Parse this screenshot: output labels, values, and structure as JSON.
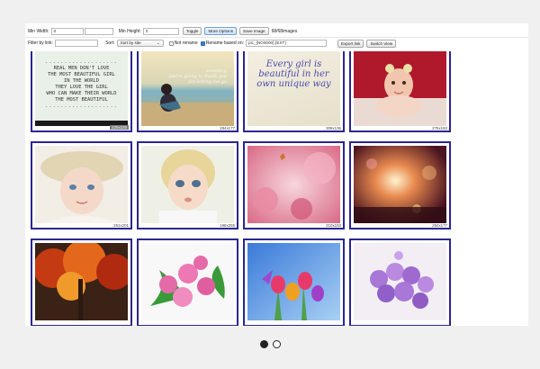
{
  "toolbar": {
    "min_width_label": "Min Width:",
    "min_width_value": "0",
    "min_height_label": "Min Height:",
    "min_height_value": "0",
    "toggle_label": "Toggle",
    "more_options_label": "More Options",
    "save_image_label": "Save Image",
    "images_count": "68/68images",
    "filter_label": "Filter by link:",
    "filter_value": "",
    "sort_label": "Sort:",
    "sort_value": "Sort by site",
    "not_rename_label": "Not rename",
    "not_rename_checked": false,
    "rename_label": "Rename based on:",
    "rename_checked": true,
    "rename_value": "pic_{NO0000}.{EXT}",
    "export_link_label": "Export link",
    "switch_view_label": "Switch View"
  },
  "tiles": [
    {
      "kind": "poem",
      "dims": "225x225",
      "lines": [
        "REAL MEN DON'T LOVE",
        "THE MOST BEAUTIFUL GIRL",
        "IN THE WORLD",
        "THEY LOVE THE GIRL",
        "WHO CAN MAKE THEIR WORLD",
        "THE MOST BEAUTIFUL"
      ],
      "dots": "..................."
    },
    {
      "kind": "beach",
      "dims": "284x177",
      "text_lines": [
        "someday,",
        "you're going to thank you",
        "for letting me go"
      ]
    },
    {
      "kind": "quote",
      "dims": "309x136",
      "lines": [
        "Every girl is",
        "beautiful in her",
        "own unique way"
      ]
    },
    {
      "kind": "baby-pink",
      "dims": "275x183"
    },
    {
      "kind": "baby-hat",
      "dims": "251x201"
    },
    {
      "kind": "toddler",
      "dims": "198x255"
    },
    {
      "kind": "pink-blossom",
      "dims": "310x163"
    },
    {
      "kind": "bokeh",
      "dims": "284x177"
    },
    {
      "kind": "autumn",
      "dims": ""
    },
    {
      "kind": "roses",
      "dims": ""
    },
    {
      "kind": "tulips",
      "dims": ""
    },
    {
      "kind": "purple-roses",
      "dims": ""
    }
  ],
  "carousel": {
    "count": 2,
    "active": 0
  },
  "colors": {
    "tile_border": "#2a2690",
    "accent": "#3b82d6"
  }
}
